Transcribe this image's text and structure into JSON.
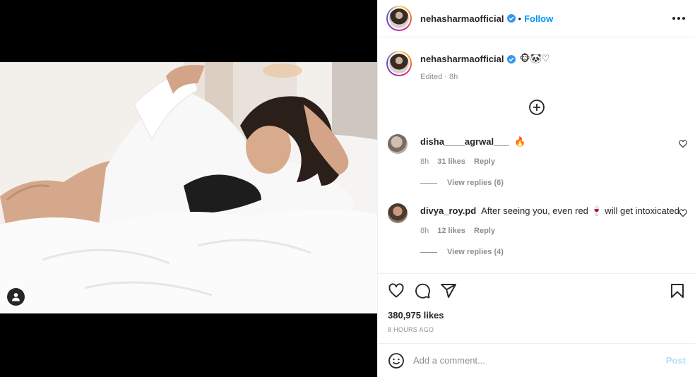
{
  "header": {
    "username": "nehasharmaofficial",
    "separator": "•",
    "follow_label": "Follow",
    "more_icon": "more-horizontal-icon",
    "verified_color": "#3897f0"
  },
  "caption": {
    "username": "nehasharmaofficial",
    "emojis": "🐵🐼♡",
    "time": "Edited · 8h"
  },
  "comments": [
    {
      "username": "disha____agrwal___",
      "text": "🔥",
      "time": "8h",
      "likes": "31 likes",
      "reply_label": "Reply",
      "view_replies": "View replies (6)"
    },
    {
      "username": "divya_roy.pd",
      "text": "After seeing you, even red 🍷 will get intoxicated.",
      "time": "8h",
      "likes": "12 likes",
      "reply_label": "Reply",
      "view_replies": "View replies (4)"
    }
  ],
  "post": {
    "likes": "380,975 likes",
    "timestamp": "8 HOURS AGO"
  },
  "add_comment": {
    "placeholder": "Add a comment...",
    "post_label": "Post"
  },
  "colors": {
    "accent": "#0095f6",
    "post_disabled": "#b2dffc",
    "muted": "#8e8e8e"
  }
}
